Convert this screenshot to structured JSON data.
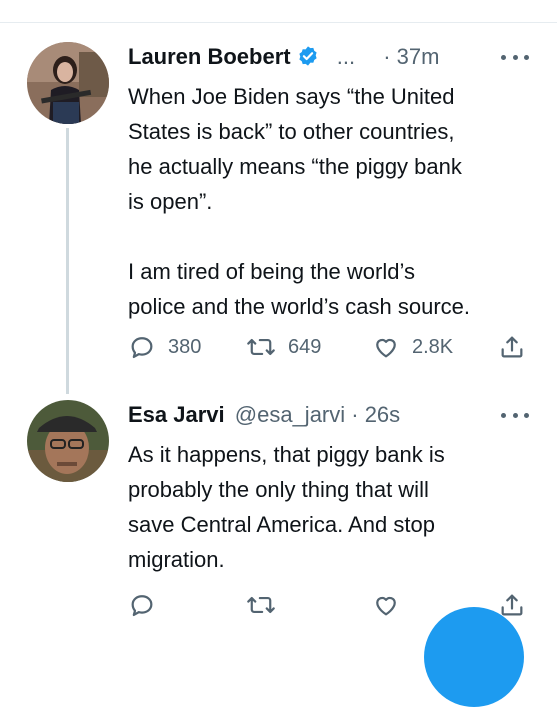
{
  "colors": {
    "accent": "#1d9bf0",
    "muted": "#536471",
    "text": "#0f1419",
    "thread_line": "#cfd9de"
  },
  "tweets": [
    {
      "name": "Lauren Boebert",
      "verified": true,
      "handle_truncated": "...",
      "time": "· 37m",
      "text": "When Joe Biden says “the United\nStates is back” to other countries,\nhe actually means “the piggy bank\nis open”.\n\nI am tired of being the world’s\npolice and the world’s cash source.",
      "reply_count": "380",
      "retweet_count": "649",
      "like_count": "2.8K",
      "icons": [
        "reply-icon",
        "retweet-icon",
        "like-icon",
        "share-icon"
      ]
    },
    {
      "name": "Esa Jarvi",
      "handle": "@esa_jarvi · 26s",
      "text": "As it happens, that piggy bank is\nprobably the only thing that will\nsave Central America. And stop\nmigration.",
      "icons": [
        "reply-icon",
        "retweet-icon",
        "like-icon",
        "share-icon"
      ]
    }
  ],
  "fab": {
    "icon": "compose-icon"
  }
}
